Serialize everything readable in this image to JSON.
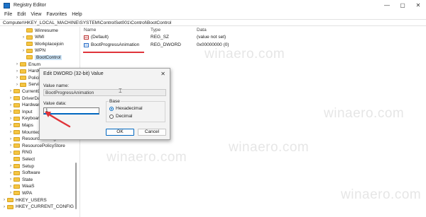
{
  "window": {
    "title": "Registry Editor",
    "minimize": "—",
    "maximize": "▢",
    "close": "✕"
  },
  "menu": [
    "File",
    "Edit",
    "View",
    "Favorites",
    "Help"
  ],
  "address": "Computer\\HKEY_LOCAL_MACHINE\\SYSTEM\\ControlSet001\\Control\\BootControl",
  "tree": [
    {
      "label": "Winresume",
      "level": 3,
      "chevron": ""
    },
    {
      "label": "WMI",
      "level": 3,
      "chevron": "›"
    },
    {
      "label": "Workplacejoin",
      "level": 3,
      "chevron": ""
    },
    {
      "label": "WPN",
      "level": 3,
      "chevron": "›"
    },
    {
      "label": "BootControl",
      "level": 3,
      "chevron": "",
      "selected": true
    },
    {
      "label": "Enum",
      "level": 2,
      "chevron": "›"
    },
    {
      "label": "Hardware",
      "level": 2,
      "chevron": "›"
    },
    {
      "label": "Policies",
      "level": 2,
      "chevron": "›"
    },
    {
      "label": "Services",
      "level": 2,
      "chevron": "›"
    },
    {
      "label": "CurrentControlSet",
      "level": 1,
      "chevron": "›"
    },
    {
      "label": "DriverDatabase",
      "level": 1,
      "chevron": "›"
    },
    {
      "label": "HardwareConfig",
      "level": 1,
      "chevron": "›"
    },
    {
      "label": "Input",
      "level": 1,
      "chevron": "›"
    },
    {
      "label": "Keyboard Layout",
      "level": 1,
      "chevron": "›"
    },
    {
      "label": "Maps",
      "level": 1,
      "chevron": "›"
    },
    {
      "label": "MountedDevices",
      "level": 1,
      "chevron": "›"
    },
    {
      "label": "ResourceManager",
      "level": 1,
      "chevron": "›"
    },
    {
      "label": "ResourcePolicyStore",
      "level": 1,
      "chevron": "›"
    },
    {
      "label": "RNG",
      "level": 1,
      "chevron": "›"
    },
    {
      "label": "Select",
      "level": 1,
      "chevron": ""
    },
    {
      "label": "Setup",
      "level": 1,
      "chevron": "›"
    },
    {
      "label": "Software",
      "level": 1,
      "chevron": "›"
    },
    {
      "label": "State",
      "level": 1,
      "chevron": "›"
    },
    {
      "label": "WaaS",
      "level": 1,
      "chevron": "›"
    },
    {
      "label": "WPA",
      "level": 1,
      "chevron": "›"
    },
    {
      "label": "HKEY_USERS",
      "level": 0,
      "chevron": "›"
    },
    {
      "label": "HKEY_CURRENT_CONFIG",
      "level": 0,
      "chevron": "›"
    }
  ],
  "list": {
    "headers": {
      "name": "Name",
      "type": "Type",
      "data": "Data"
    },
    "rows": [
      {
        "name": "(Default)",
        "type": "REG_SZ",
        "data": "(value not set)",
        "icon": "string-value-icon"
      },
      {
        "name": "BootProgressAnimation",
        "type": "REG_DWORD",
        "data": "0x00000000 (0)",
        "icon": "dword-value-icon"
      }
    ]
  },
  "dialog": {
    "title": "Edit DWORD (32-bit) Value",
    "close": "✕",
    "value_name_label": "Value name:",
    "value_name": "BootProgressAnimation",
    "value_data_label": "Value data:",
    "value_data": "1",
    "base_label": "Base",
    "base_options": [
      "Hexadecimal",
      "Decimal"
    ],
    "base_selected": "Hexadecimal",
    "ok": "OK",
    "cancel": "Cancel"
  },
  "watermark": "winaero.com",
  "colors": {
    "accent": "#0067c0",
    "annotation_red": "#e0343a",
    "folder": "#f5c542",
    "selection": "#cce4f7"
  }
}
